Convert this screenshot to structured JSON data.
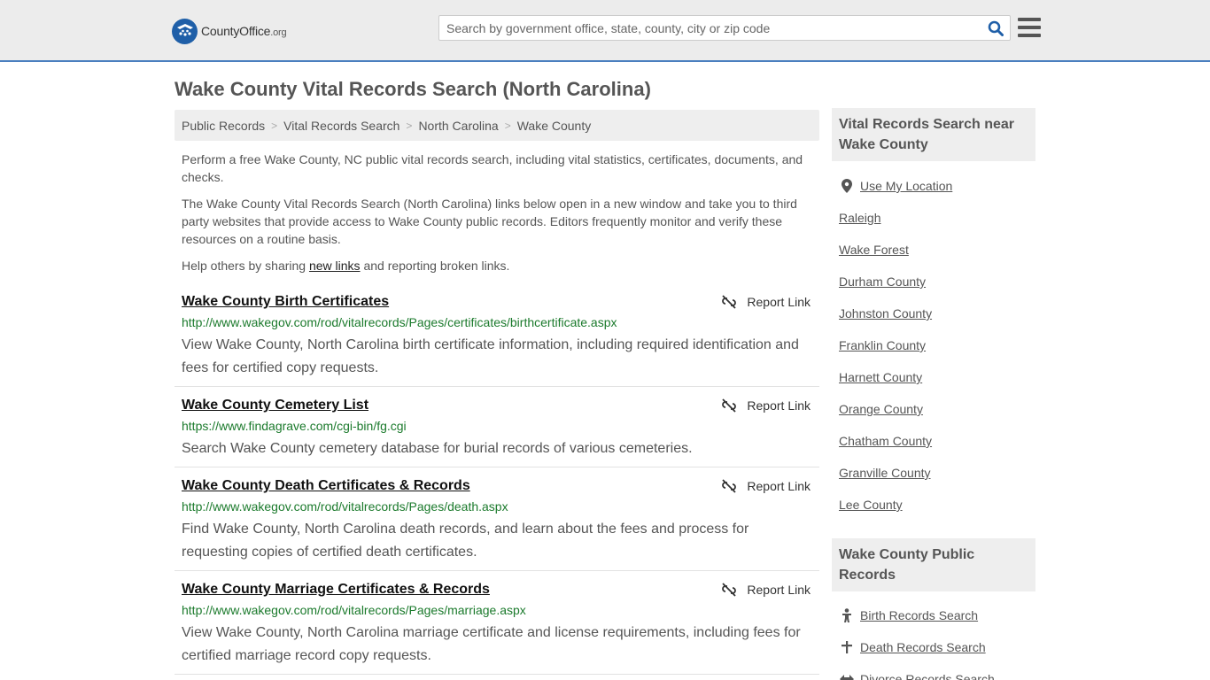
{
  "header": {
    "logo_main": "CountyOffice",
    "logo_suffix": ".org",
    "search_placeholder": "Search by government office, state, county, city or zip code"
  },
  "page_title": "Wake County Vital Records Search (North Carolina)",
  "breadcrumb": [
    "Public Records",
    "Vital Records Search",
    "North Carolina",
    "Wake County"
  ],
  "intro": {
    "p1": "Perform a free Wake County, NC public vital records search, including vital statistics, certificates, documents, and checks.",
    "p2": "The Wake County Vital Records Search (North Carolina) links below open in a new window and take you to third party websites that provide access to Wake County public records. Editors frequently monitor and verify these resources on a routine basis.",
    "p3_before": "Help others by sharing ",
    "p3_link": "new links",
    "p3_after": " and reporting broken links."
  },
  "report_label": "Report Link",
  "records": [
    {
      "title": "Wake County Birth Certificates",
      "url": "http://www.wakegov.com/rod/vitalrecords/Pages/certificates/birthcertificate.aspx",
      "desc": "View Wake County, North Carolina birth certificate information, including required identification and fees for certified copy requests."
    },
    {
      "title": "Wake County Cemetery List",
      "url": "https://www.findagrave.com/cgi-bin/fg.cgi",
      "desc": "Search Wake County cemetery database for burial records of various cemeteries."
    },
    {
      "title": "Wake County Death Certificates & Records",
      "url": "http://www.wakegov.com/rod/vitalrecords/Pages/death.aspx",
      "desc": "Find Wake County, North Carolina death records, and learn about the fees and process for requesting copies of certified death certificates."
    },
    {
      "title": "Wake County Marriage Certificates & Records",
      "url": "http://www.wakegov.com/rod/vitalrecords/Pages/marriage.aspx",
      "desc": "View Wake County, North Carolina marriage certificate and license requirements, including fees for certified marriage record copy requests."
    }
  ],
  "sidebar": {
    "near_heading": "Vital Records Search near Wake County",
    "use_location": "Use My Location",
    "near_links": [
      "Raleigh",
      "Wake Forest",
      "Durham County",
      "Johnston County",
      "Franklin County",
      "Harnett County",
      "Orange County",
      "Chatham County",
      "Granville County",
      "Lee County"
    ],
    "public_heading": "Wake County Public Records",
    "public_links": [
      {
        "label": "Birth Records Search",
        "icon": "baby-icon"
      },
      {
        "label": "Death Records Search",
        "icon": "cross-icon"
      },
      {
        "label": "Divorce Records Search",
        "icon": "arrows-icon"
      }
    ]
  },
  "colors": {
    "accent_border": "#4a7fbf",
    "logo_blue": "#1f5fa8",
    "url_green": "#1b7a2c",
    "search_icon": "#1f5fa8"
  }
}
